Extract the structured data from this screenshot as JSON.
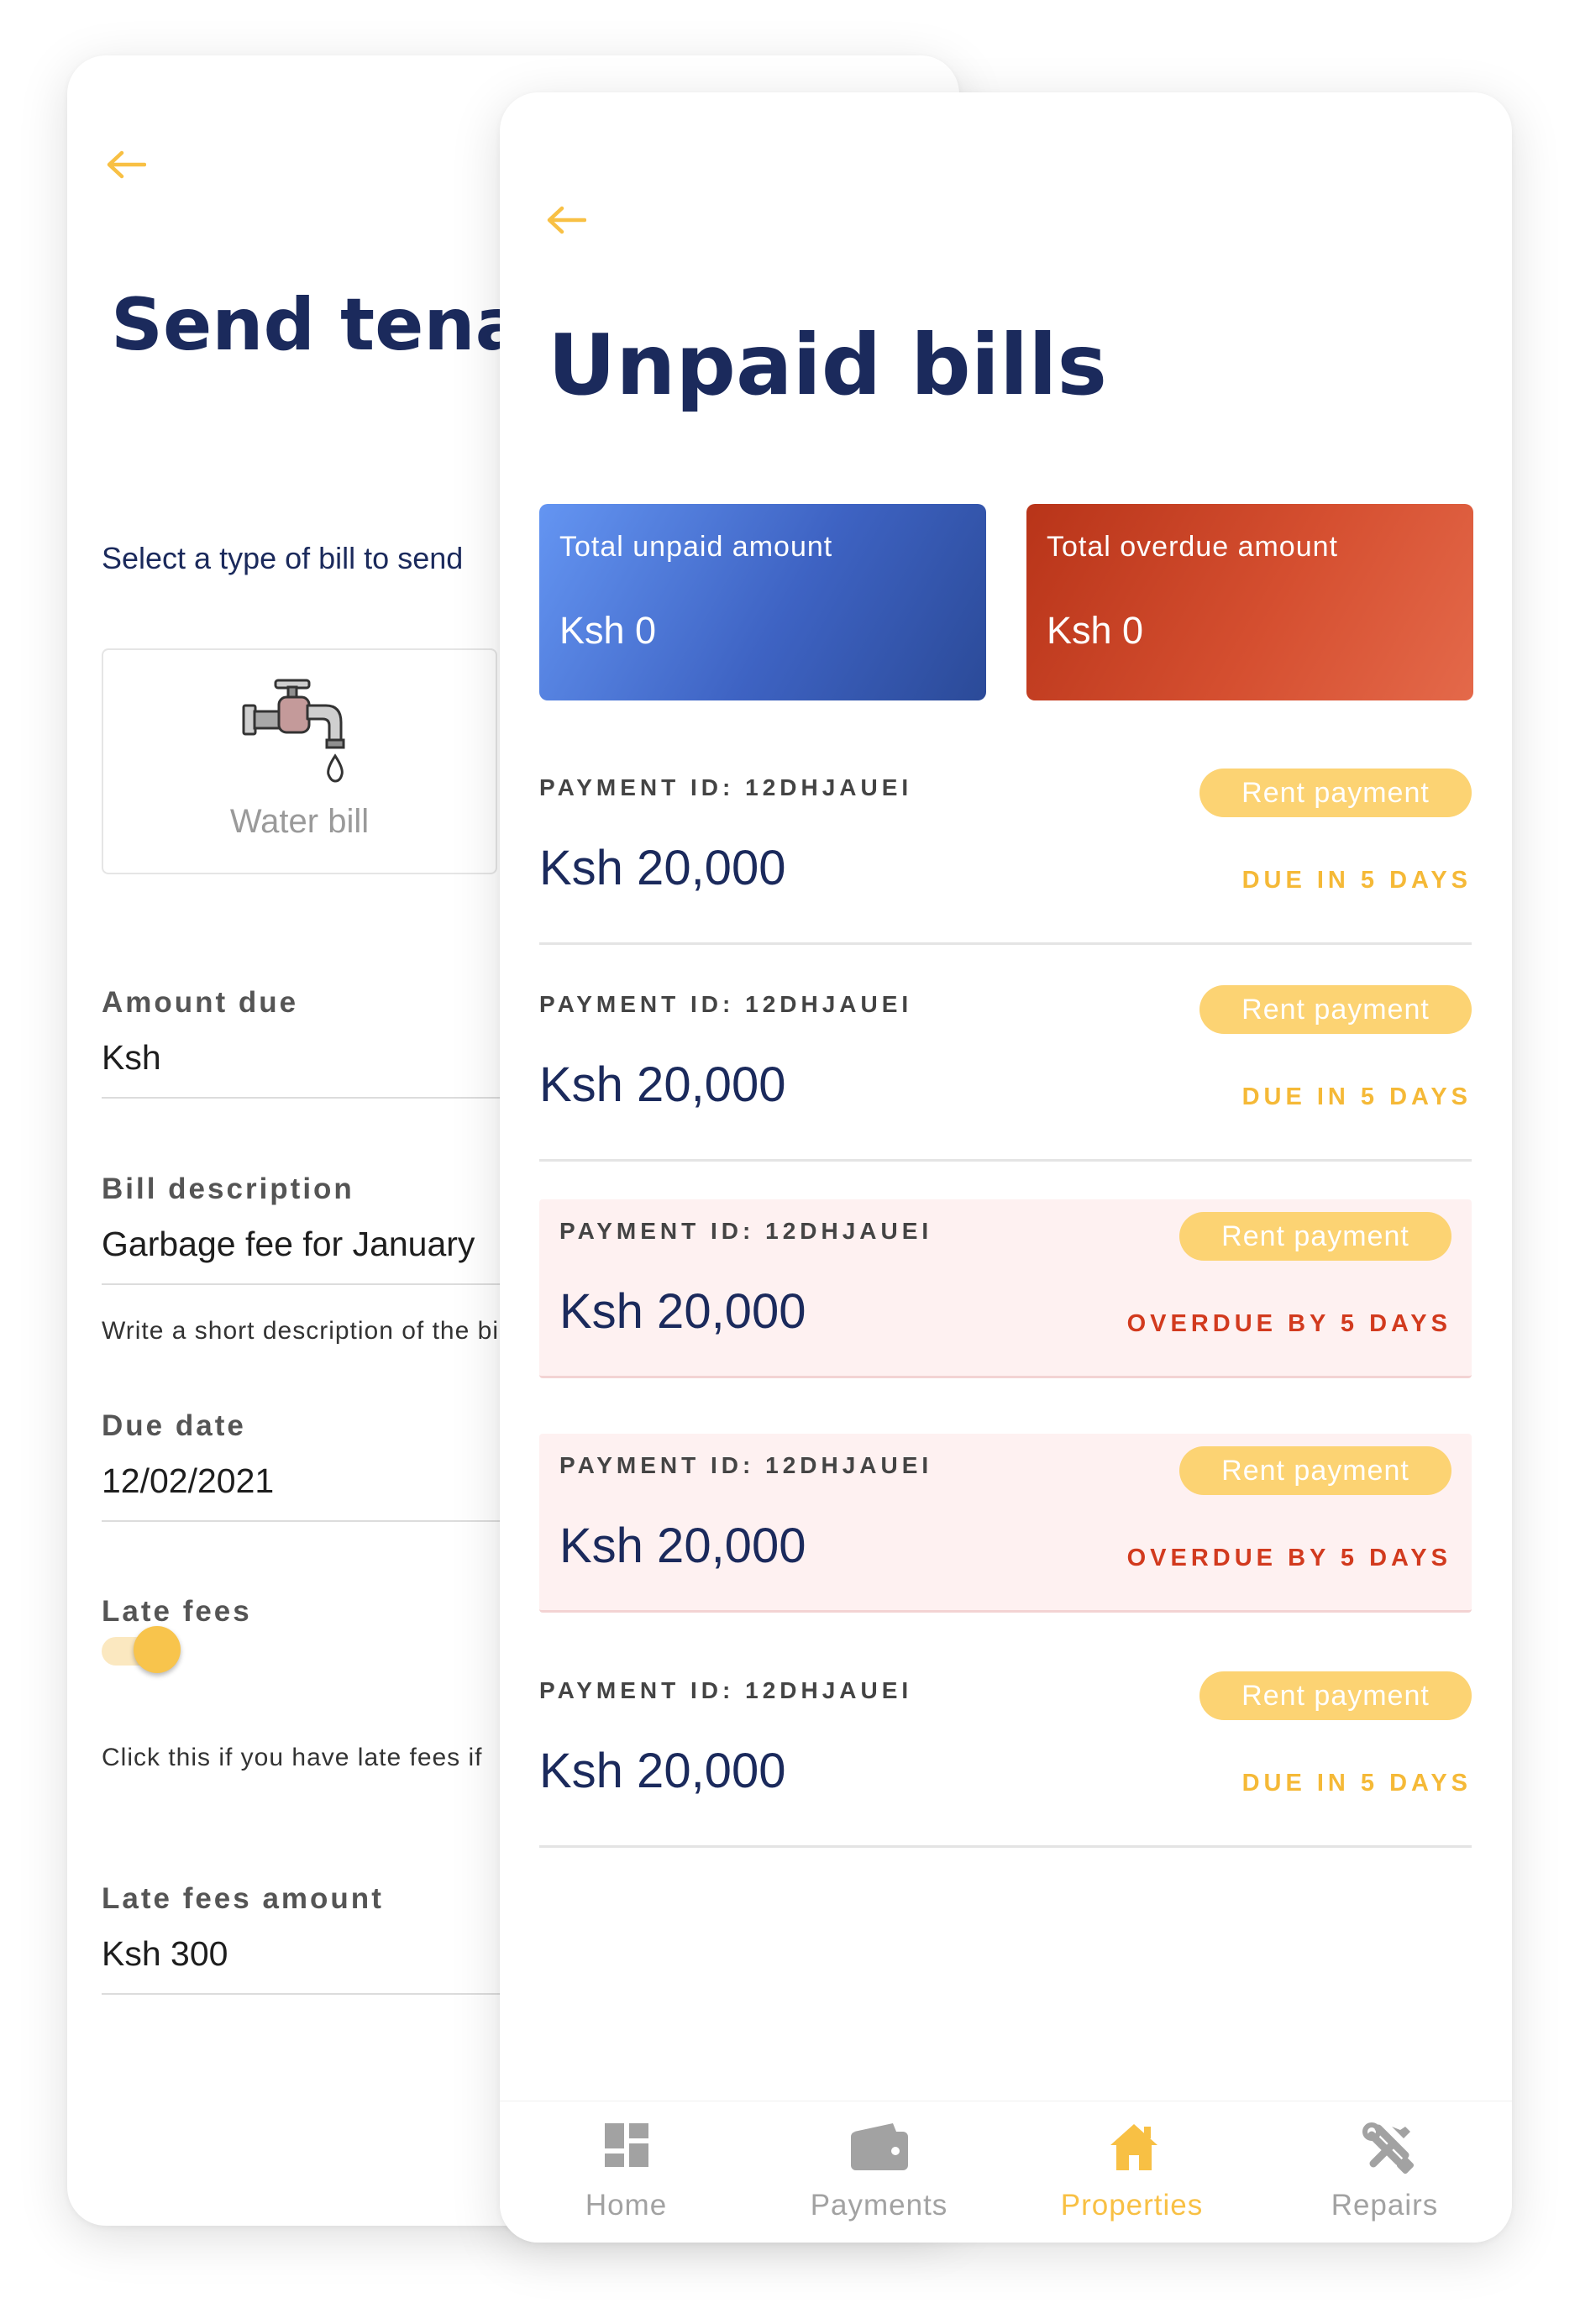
{
  "send_bill_screen": {
    "title": "Send tenant bill",
    "subtitle": "Select a type of bill to send",
    "bill_types": [
      {
        "label": "Water bill",
        "icon": "water-tap-icon"
      }
    ],
    "fields": {
      "amount_due": {
        "label": "Amount due",
        "value": "Ksh"
      },
      "bill_description": {
        "label": "Bill description",
        "value": "Garbage fee for January",
        "helper": "Write a short description of the bill"
      },
      "due_date": {
        "label": "Due date",
        "value": "12/02/2021"
      },
      "late_fees": {
        "label": "Late fees",
        "enabled": true,
        "helper": "Click this if you have late fees if"
      },
      "late_fees_amount": {
        "label": "Late fees amount",
        "value": "Ksh 300"
      }
    }
  },
  "unpaid_bills_screen": {
    "title": "Unpaid bills",
    "summary": {
      "unpaid": {
        "label": "Total unpaid amount",
        "value": "Ksh 0"
      },
      "overdue": {
        "label": "Total overdue amount",
        "value": "Ksh 0"
      }
    },
    "bills": [
      {
        "payment_id": "PAYMENT ID: 12DHJAUEI",
        "amount": "Ksh 20,000",
        "tag": "Rent payment",
        "status": "DUE IN 5 DAYS",
        "overdue": false
      },
      {
        "payment_id": "PAYMENT ID: 12DHJAUEI",
        "amount": "Ksh 20,000",
        "tag": "Rent payment",
        "status": "DUE IN 5 DAYS",
        "overdue": false
      },
      {
        "payment_id": "PAYMENT ID: 12DHJAUEI",
        "amount": "Ksh 20,000",
        "tag": "Rent payment",
        "status": "OVERDUE BY 5 DAYS",
        "overdue": true
      },
      {
        "payment_id": "PAYMENT ID: 12DHJAUEI",
        "amount": "Ksh 20,000",
        "tag": "Rent payment",
        "status": "OVERDUE BY 5 DAYS",
        "overdue": true
      },
      {
        "payment_id": "PAYMENT ID: 12DHJAUEI",
        "amount": "Ksh 20,000",
        "tag": "Rent payment",
        "status": "DUE IN 5 DAYS",
        "overdue": false
      }
    ],
    "bottom_nav": [
      {
        "label": "Home",
        "icon": "dashboard-grid-icon",
        "active": false
      },
      {
        "label": "Payments",
        "icon": "wallet-icon",
        "active": false
      },
      {
        "label": "Properties",
        "icon": "house-icon",
        "active": true
      },
      {
        "label": "Repairs",
        "icon": "tools-icon",
        "active": false
      }
    ]
  },
  "colors": {
    "navy_text": "#1b2a5c",
    "accent_yellow": "#f8c044",
    "due_status": "#f5b937",
    "overdue_status": "#d23a1e",
    "unpaid_card_gradient": [
      "#6495f2",
      "#2b4a98"
    ],
    "overdue_card_gradient": [
      "#b83419",
      "#e4694a"
    ],
    "overdue_row_bg": "#fef1f1",
    "tag_bg": "#fcd373"
  }
}
